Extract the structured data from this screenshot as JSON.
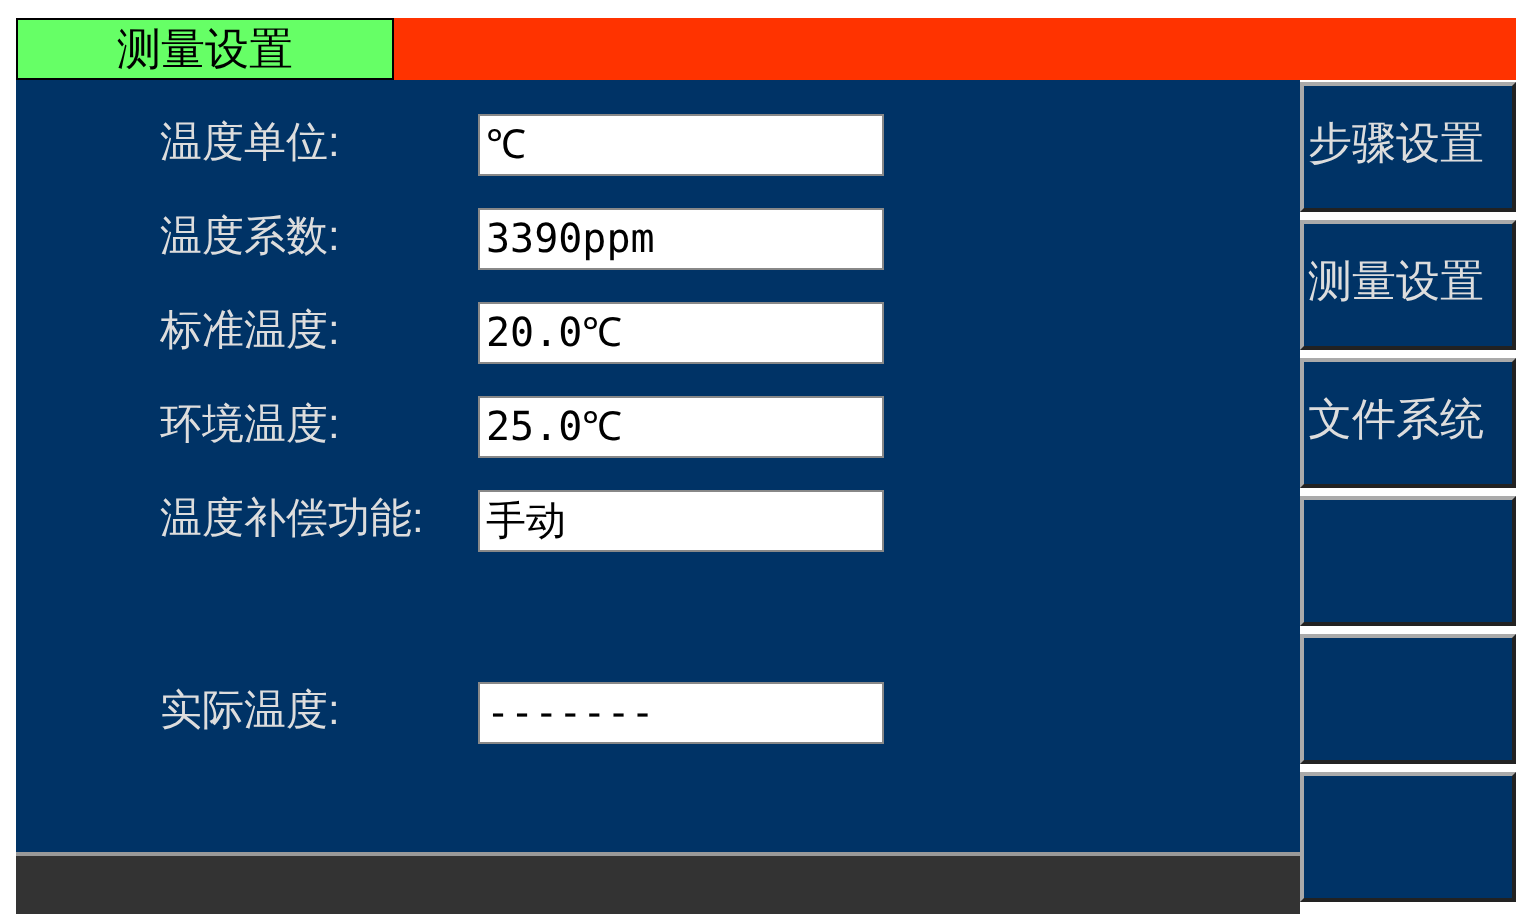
{
  "title_tab": "测量设置",
  "settings": [
    {
      "label": "温度单位:",
      "value": "℃"
    },
    {
      "label": "温度系数:",
      "value": "3390ppm"
    },
    {
      "label": "标准温度:",
      "value": "20.0℃"
    },
    {
      "label": "环境温度:",
      "value": "25.0℃"
    },
    {
      "label": "温度补偿功能:",
      "value": "手动"
    }
  ],
  "reading": {
    "label": "实际温度:",
    "value": "-------"
  },
  "side_buttons": [
    {
      "kind": "text",
      "label": "步骤设置"
    },
    {
      "kind": "text",
      "label": "测量设置"
    },
    {
      "kind": "text",
      "label": "文件系统"
    },
    {
      "kind": "blank"
    },
    {
      "kind": "blank"
    },
    {
      "kind": "blank"
    }
  ]
}
